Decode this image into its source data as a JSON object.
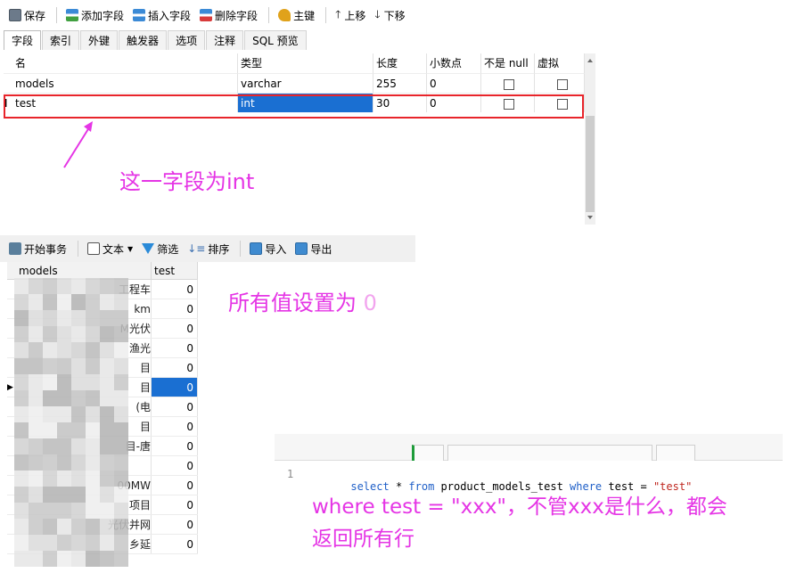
{
  "designer": {
    "toolbar": {
      "save": "保存",
      "add_field": "添加字段",
      "insert_field": "插入字段",
      "delete_field": "删除字段",
      "primary_key": "主键",
      "move_up": "上移",
      "move_down": "下移"
    },
    "tabs": [
      "字段",
      "索引",
      "外键",
      "触发器",
      "选项",
      "注释",
      "SQL 预览"
    ],
    "columns": {
      "name": "名",
      "type": "类型",
      "length": "长度",
      "decimals": "小数点",
      "not_null": "不是 null",
      "virtual": "虚拟"
    },
    "fields": [
      {
        "name": "models",
        "type": "varchar",
        "length": "255",
        "decimals": "0"
      },
      {
        "name": "test",
        "type": "int",
        "length": "30",
        "decimals": "0"
      }
    ],
    "row_indicator": "I",
    "annotation": "这一字段为int"
  },
  "datagrid": {
    "toolbar": {
      "begin_tx": "开始事务",
      "text": "文本",
      "filter": "筛选",
      "sort": "排序",
      "import": "导入",
      "export": "导出"
    },
    "columns": {
      "models": "models",
      "test": "test"
    },
    "rows": [
      {
        "models": "工程车",
        "test": "0"
      },
      {
        "models": "km",
        "test": "0"
      },
      {
        "models": "M光伏",
        "test": "0"
      },
      {
        "models": "渔光",
        "test": "0"
      },
      {
        "models": "目",
        "test": "0"
      },
      {
        "models": "目",
        "test": "0"
      },
      {
        "models": "(电",
        "test": "0"
      },
      {
        "models": "目",
        "test": "0"
      },
      {
        "models": "目-唐",
        "test": "0"
      },
      {
        "models": "",
        "test": "0"
      },
      {
        "models": "00MW",
        "test": "0"
      },
      {
        "models": "项目",
        "test": "0"
      },
      {
        "models": "光伏并网",
        "test": "0"
      },
      {
        "models": "乡延",
        "test": "0"
      }
    ],
    "current_row": 5,
    "annotation_prefix": "所有值设置为 ",
    "annotation_value": "0"
  },
  "sqleditor": {
    "line_number": "1",
    "sql": {
      "kw_select": "select",
      "star": " * ",
      "kw_from": "from",
      "table": " product_models_test ",
      "kw_where": "where",
      "cond": " test = ",
      "value": "\"test\""
    },
    "annotation_line1": "where test = \"xxx\"，不管xxx是什么，都会",
    "annotation_line2": "返回所有行"
  },
  "colors": {
    "annotation": "#e535e5",
    "highlight_box": "#e8252b",
    "selection": "#1a6fd2",
    "sql_keyword": "#2060c8",
    "sql_string": "#c02820"
  }
}
